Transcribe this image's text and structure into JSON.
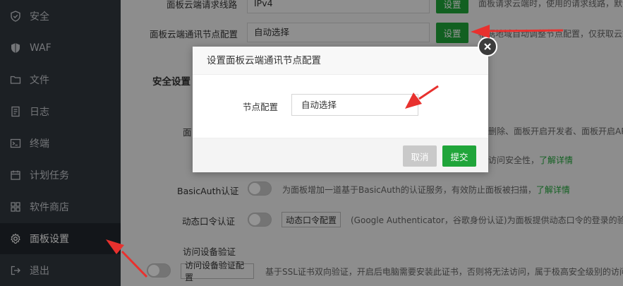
{
  "sidebar": {
    "items": [
      {
        "label": "安全",
        "icon": "shield-check-icon"
      },
      {
        "label": "WAF",
        "icon": "shield-filled-icon"
      },
      {
        "label": "文件",
        "icon": "folder-icon"
      },
      {
        "label": "日志",
        "icon": "log-icon"
      },
      {
        "label": "终端",
        "icon": "terminal-icon"
      },
      {
        "label": "计划任务",
        "icon": "calendar-icon"
      },
      {
        "label": "软件商店",
        "icon": "grid-icon"
      },
      {
        "label": "面板设置",
        "icon": "gear-icon",
        "active": true
      },
      {
        "label": "退出",
        "icon": "logout-icon"
      }
    ]
  },
  "settings": {
    "request_line": {
      "label": "面板云端请求线路",
      "value": "IPv4",
      "button": "设置",
      "hint": "面板请求云端时，使用的请求线路，默认"
    },
    "node_config": {
      "label": "面板云端通讯节点配置",
      "value": "自动选择",
      "button": "设置",
      "hint": "根据地域自动调整节点配置，仅获取云端数"
    },
    "security_section": "安全设置",
    "row_hidden_label": "面",
    "row_hidden_hint": "删除、面板开启开发者、面板开启AP",
    "access_row_hint": "访问安全性，",
    "access_row_link": "了解详情",
    "basic_auth": {
      "label": "BasicAuth认证",
      "hint": "为面板增加一道基于BasicAuth的认证服务，有效防止面板被扫描，",
      "link": "了解详情"
    },
    "dynamic_otp": {
      "label": "动态口令认证",
      "button": "动态口令配置",
      "hint": "(Google Authenticator，谷歌身份认证)为面板提供动态口令的登录的验证"
    },
    "device_verify": {
      "label": "访问设备验证",
      "button": "访问设备验证配置",
      "hint": "基于SSL证书双向验证，开启后电脑需要安装此证书，否则将无法访问，属于极高安全级别的访问"
    }
  },
  "modal": {
    "title": "设置面板云端通讯节点配置",
    "field_label": "节点配置",
    "field_value": "自动选择",
    "cancel": "取消",
    "submit": "提交"
  },
  "colors": {
    "accent": "#20a53a",
    "sidebar_bg": "#31373f",
    "arrow": "#e8312e"
  }
}
